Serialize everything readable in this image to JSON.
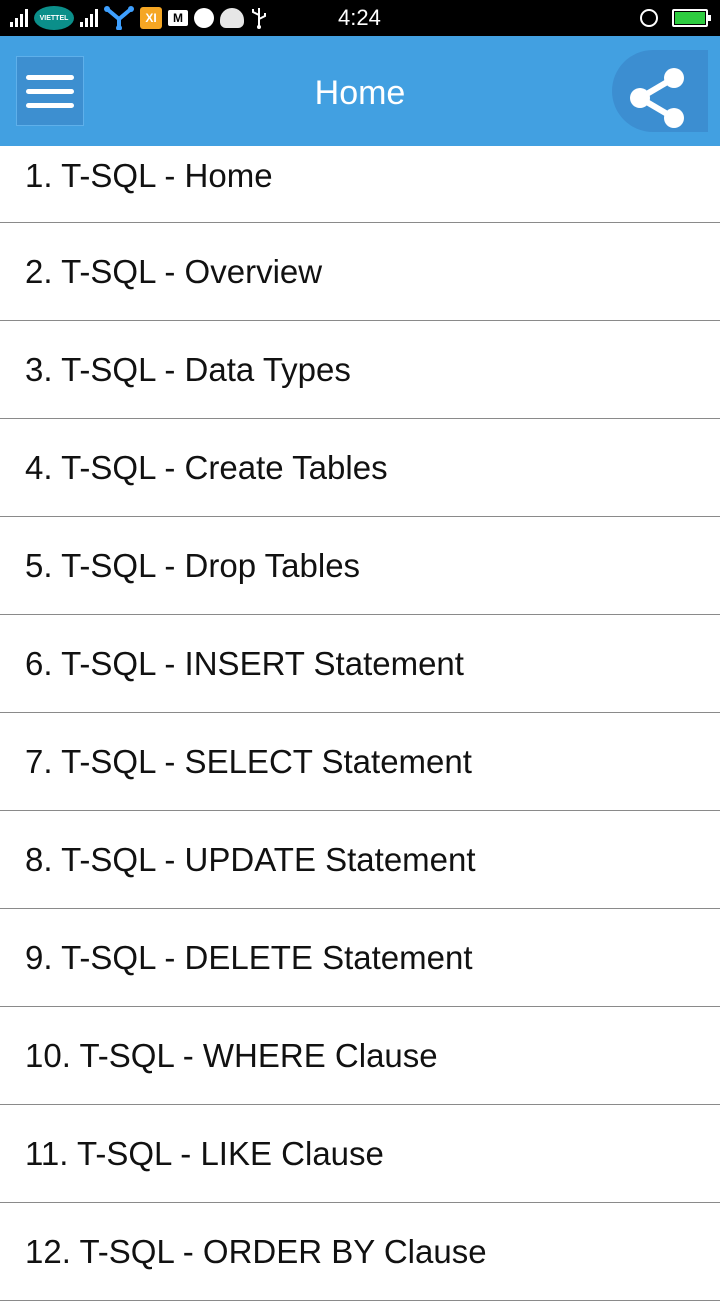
{
  "status_bar": {
    "carrier": "VIETTEL",
    "app_badge": "XI",
    "mail_glyph": "M",
    "time": "4:24",
    "battery_color": "#2ecc40"
  },
  "app_bar": {
    "title": "Home",
    "background": "#42a0e1",
    "menu_icon": "hamburger-menu-icon",
    "share_icon": "share-icon"
  },
  "topics": [
    "1. T-SQL - Home",
    "2. T-SQL - Overview",
    "3. T-SQL - Data Types",
    "4. T-SQL - Create Tables",
    "5. T-SQL - Drop Tables",
    "6. T-SQL - INSERT Statement",
    "7. T-SQL - SELECT Statement",
    "8. T-SQL - UPDATE Statement",
    "9. T-SQL - DELETE Statement",
    "10. T-SQL - WHERE Clause",
    "11. T-SQL - LIKE Clause",
    "12. T-SQL - ORDER BY Clause"
  ]
}
